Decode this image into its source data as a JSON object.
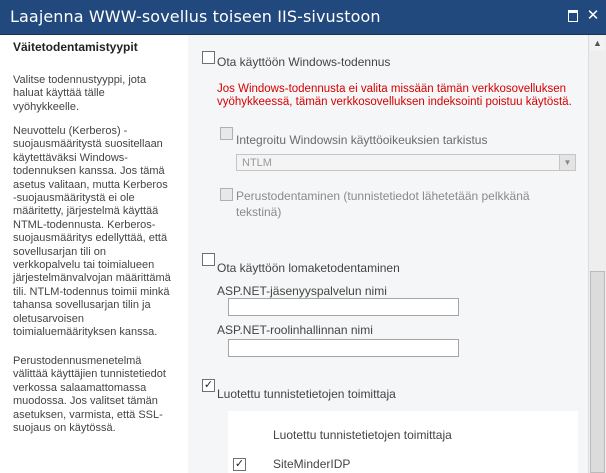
{
  "window": {
    "title": "Laajenna WWW-sovellus toiseen IIS-sivustoon",
    "maximize_label": "",
    "close_label": "✕"
  },
  "left": {
    "section_title": "Väitetodentamistyypit",
    "paragraphs": [
      "Valitse todennustyyppi, jota haluat käyttää tälle vyöhykkeelle.",
      "Neuvottelu (Kerberos) -suojausmääritystä suositellaan käytettäväksi Windows-todennuksen kanssa. Jos tämä asetus valitaan, mutta Kerberos -suojausmääritystä ei ole määritetty, järjestelmä käyttää NTML-todennusta. Kerberos-suojausmääritys edellyttää, että sovellusarjan tili on verkkopalvelu tai toimialueen järjestelmänvalvojan määrittämä tili. NTLM-todennus toimii minkä tahansa sovellusarjan tilin ja oletusarvoisen toimialuemäärityksen kanssa.",
      "Perustodennusmenetelmä välittää käyttäjien tunnistetiedot verkossa salaamattomassa muodossa. Jos valitset tämän asetuksen, varmista, että SSL-suojaus on käytössä."
    ]
  },
  "form": {
    "windows_auth": {
      "label": "Ota käyttöön Windows-todennus",
      "checked": false
    },
    "warning": "Jos Windows-todennusta ei valita missään tämän verkkosovelluksen vyöhykkeessä, tämän verkkosovelluksen indeksointi poistuu käytöstä.",
    "integrated": {
      "label": "Integroitu Windowsin käyttöoikeuksien tarkistus",
      "checked": false
    },
    "integrated_select": {
      "value": "NTLM"
    },
    "basic": {
      "label_line1": "Perustodentaminen (tunnistetiedot lähetetään pelkkänä",
      "label_line2": "tekstinä)",
      "checked": false
    },
    "forms_auth": {
      "label": "Ota käyttöön lomaketodentaminen",
      "checked": false
    },
    "membership_label": "ASP.NET-jäsenyyspalvelun nimi",
    "membership_value": "",
    "role_label": "ASP.NET-roolinhallinnan nimi",
    "role_value": "",
    "trusted": {
      "label": "Luotettu tunnistetietojen toimittaja",
      "checked": true
    },
    "trusted_panel_title": "Luotettu tunnistetietojen toimittaja",
    "providers": [
      {
        "name": "SiteMinderIDP",
        "checked": true
      }
    ],
    "check_glyph": "✓"
  }
}
